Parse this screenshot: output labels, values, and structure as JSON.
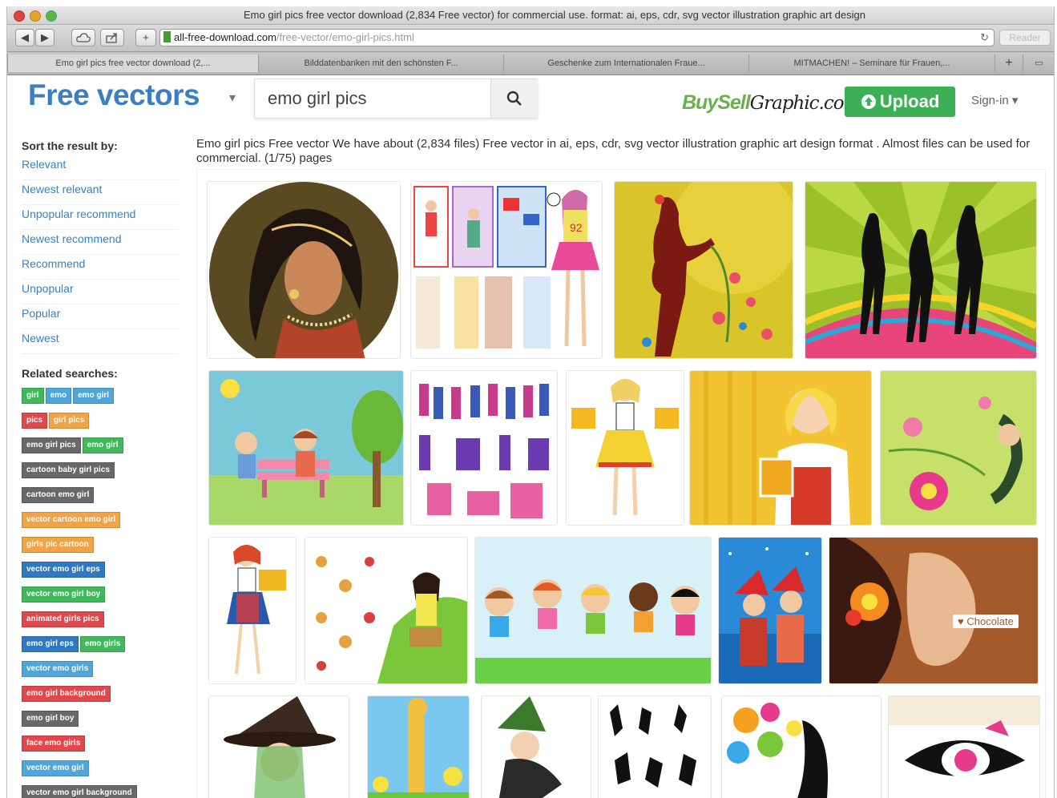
{
  "browser": {
    "window_title": "Emo girl pics free vector download (2,834 Free vector) for commercial use. format: ai, eps, cdr, svg vector illustration graphic art design",
    "url_host": "all-free-download.com",
    "url_path": "/free-vector/emo-girl-pics.html",
    "reader_label": "Reader",
    "tabs": [
      {
        "label": "Emo girl pics free vector download (2,..."
      },
      {
        "label": "Bilddatenbanken mit den schönsten F..."
      },
      {
        "label": "Geschenke zum Internationalen Fraue..."
      },
      {
        "label": "MITMACHEN! – Seminare für Frauen,..."
      }
    ],
    "new_tab_label": "+"
  },
  "header": {
    "logo": "Free vectors",
    "logo_caret": "▾",
    "search_value": "emo girl pics",
    "buysell_a": "BuySell",
    "buysell_b": "Graphic.com",
    "upload_label": "Upload",
    "signin_label": "Sign-in ▾"
  },
  "sidebar": {
    "sort_title": "Sort the result by:",
    "sort_links": [
      "Relevant",
      "Newest relevant",
      "Unpopular recommend",
      "Newest recommend",
      "Recommend",
      "Unpopular",
      "Popular",
      "Newest"
    ],
    "related_title": "Related searches:",
    "tag_rows": [
      [
        {
          "label": "girl",
          "color": "green"
        },
        {
          "label": "emo",
          "color": "blue"
        },
        {
          "label": "emo girl",
          "color": "blue"
        }
      ],
      [
        {
          "label": "pics",
          "color": "red"
        },
        {
          "label": "girl pics",
          "color": "orange"
        }
      ],
      [
        {
          "label": "emo girl pics",
          "color": "gray"
        },
        {
          "label": "emo girl",
          "color": "green"
        }
      ],
      [
        {
          "label": "cartoon baby girl pics",
          "color": "gray"
        }
      ],
      [
        {
          "label": "cartoon emo girl",
          "color": "gray"
        }
      ],
      [
        {
          "label": "vector cartoon emo girl",
          "color": "orange"
        }
      ],
      [
        {
          "label": "girls pic cartoon",
          "color": "orange"
        }
      ],
      [
        {
          "label": "vector emo girl eps",
          "color": "dblue"
        }
      ],
      [
        {
          "label": "vector emo girl boy",
          "color": "green"
        }
      ],
      [
        {
          "label": "animated girls pics",
          "color": "red"
        }
      ],
      [
        {
          "label": "emo girl eps",
          "color": "dblue"
        },
        {
          "label": "emo girls",
          "color": "green"
        }
      ],
      [
        {
          "label": "vector emo girls",
          "color": "blue"
        }
      ],
      [
        {
          "label": "emo girl background",
          "color": "red"
        }
      ],
      [
        {
          "label": "emo girl boy",
          "color": "gray"
        }
      ],
      [
        {
          "label": "face emo girls",
          "color": "red"
        }
      ],
      [
        {
          "label": "vector emo girl",
          "color": "blue"
        }
      ],
      [
        {
          "label": "vector emo girl background",
          "color": "gray"
        }
      ]
    ]
  },
  "main": {
    "summary": "Emo girl pics Free vector We have about (2,834 files) Free vector in ai, eps, cdr, svg vector illustration graphic art design format . Almost files can be used for commercial. (1/75) pages",
    "chocolate_label": "Chocolate",
    "jersey_number": "92"
  }
}
